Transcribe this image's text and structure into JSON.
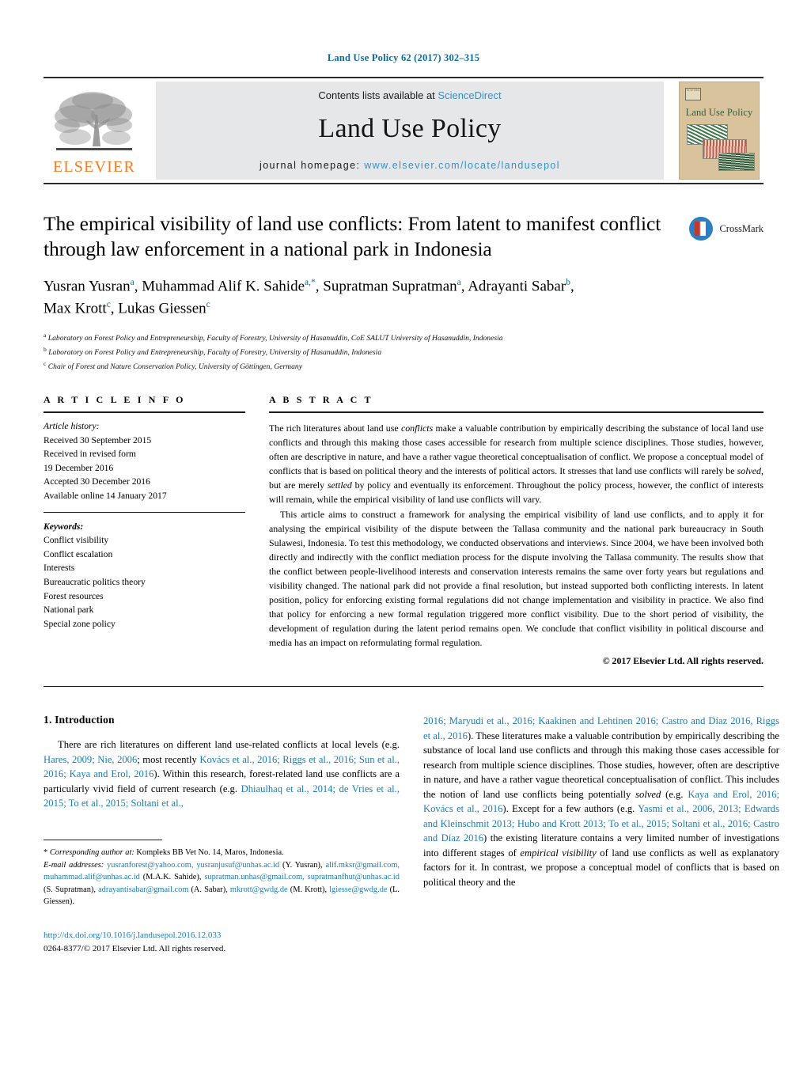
{
  "running_head": "Land Use Policy 62 (2017) 302–315",
  "banner": {
    "contents_prefix": "Contents lists available at ",
    "sciencedirect": "ScienceDirect",
    "journal_title": "Land Use Policy",
    "homepage_prefix": "journal homepage: ",
    "homepage_url": "www.elsevier.com/locate/landusepol",
    "elsevier_wordmark": "ELSEVIER",
    "cover_title": "Land Use Policy",
    "cover_logo_text": "ELSEVIER"
  },
  "colors": {
    "link_blue": "#1a7db5",
    "header_blue": "#0b6ca0",
    "elsevier_orange": "#f47b20",
    "banner_grey": "#e6e7e9",
    "cover_tan": "#d9c39c",
    "cover_green": "#2f6043"
  },
  "article": {
    "title": "The empirical visibility of land use conflicts: From latent to manifest conflict through law enforcement in a national park in Indonesia",
    "authors_line1": "Yusran Yusran",
    "authors": "Yusran Yusrana, Muhammad Alif K. Sahidea,*, Supratman Supratmana, Adrayanti Sabarb, Max Krottc, Lukas Giessenc",
    "crossmark_label": "CrossMark",
    "affiliations": [
      {
        "mark": "a",
        "text": "Laboratory on Forest Policy and Entrepreneurship, Faculty of Forestry, University of Hasanuddin, CoE SALUT University of Hasanuddin, Indonesia"
      },
      {
        "mark": "b",
        "text": "Laboratory on Forest Policy and Entrepreneurship, Faculty of Forestry, University of Hasanuddin, Indonesia"
      },
      {
        "mark": "c",
        "text": "Chair of Forest and Nature Conservation Policy, University of Göttingen, Germany"
      }
    ]
  },
  "article_info": {
    "heading": "A R T I C L E   I N F O",
    "history_label": "Article history:",
    "history": [
      "Received 30 September 2015",
      "Received in revised form",
      "19 December 2016",
      "Accepted 30 December 2016",
      "Available online 14 January 2017"
    ],
    "keywords_label": "Keywords:",
    "keywords": [
      "Conflict visibility",
      "Conflict escalation",
      "Interests",
      "Bureaucratic politics theory",
      "Forest resources",
      "National park",
      "Special zone policy"
    ]
  },
  "abstract": {
    "heading": "A B S T R A C T",
    "paragraph1_a": "The rich literatures about land use ",
    "paragraph1_i1": "conflicts",
    "paragraph1_b": " make a valuable contribution by empirically describing the substance of local land use conflicts and through this making those cases accessible for research from multiple science disciplines. Those studies, however, often are descriptive in nature, and have a rather vague theoretical conceptualisation of conflict. We propose a conceptual model of conflicts that is based on political theory and the interests of political actors. It stresses that land use conflicts will rarely be ",
    "paragraph1_i2": "solved",
    "paragraph1_c": ", but are merely ",
    "paragraph1_i3": "settled",
    "paragraph1_d": " by policy and eventually its enforcement. Throughout the policy process, however, the conflict of interests will remain, while the empirical visibility of land use conflicts will vary.",
    "paragraph2": "This article aims to construct a framework for analysing the empirical visibility of land use conflicts, and to apply it for analysing the empirical visibility of the dispute between the Tallasa community and the national park bureaucracy in South Sulawesi, Indonesia. To test this methodology, we conducted observations and interviews. Since 2004, we have been involved both directly and indirectly with the conflict mediation process for the dispute involving the Tallasa community. The results show that the conflict between people-livelihood interests and conservation interests remains the same over forty years but regulations and visibility changed. The national park did not provide a final resolution, but instead supported both conflicting interests. In latent position, policy for enforcing existing formal regulations did not change implementation and visibility in practice. We also find that policy for enforcing a new formal regulation triggered more conflict visibility. Due to the short period of visibility, the development of regulation during the latent period remains open. We conclude that conflict visibility in political discourse and media has an impact on reformulating formal regulation.",
    "copyright": "© 2017 Elsevier Ltd. All rights reserved."
  },
  "introduction": {
    "section_title": "1.  Introduction",
    "left_p1_a": "There are rich literatures on different land use-related conflicts at local levels (e.g. ",
    "left_p1_cite1": "Hares, 2009; Nie, 2006",
    "left_p1_b": "; most recently ",
    "left_p1_cite2": "Kovács et al., 2016; Riggs et al., 2016; Sun et al., 2016; Kaya and Erol, 2016",
    "left_p1_c": "). Within this research, forest-related land use conflicts are a particularly vivid field of current research (e.g. ",
    "left_p1_cite3": "Dhiaulhaq et al., 2014; de Vries et al., 2015; To et al., 2015; Soltani et al.,",
    "right_cite_start": "2016; Maryudi et al., 2016; Kaakinen and Lehtinen 2016; Castro and Díaz 2016, Riggs et al., 2016",
    "right_p1_a": "). These literatures make a valuable contribution by empirically describing the substance of local land use conflicts and through this making those cases accessible for research from multiple science disciplines. Those studies, however, often are descriptive in nature, and have a rather vague theoretical conceptualisation of conflict. This includes the notion of land use conflicts being potentially ",
    "right_p1_i1": "solved",
    "right_p1_b": " (e.g. ",
    "right_cite2": "Kaya and Erol, 2016; Kovács et al., 2016",
    "right_p1_c": "). Except for a few authors (e.g. ",
    "right_cite3": "Yasmi et al., 2006, 2013; Edwards and Kleinschmit 2013; Hubo and Krott 2013; To et al., 2015; Soltani et al., 2016; Castro and Díaz 2016",
    "right_p1_d": ") the existing literature contains a very limited number of investigations into different stages of ",
    "right_p1_i2": "empirical visibility",
    "right_p1_e": " of land use conflicts as well as explanatory factors for it. In contrast, we propose a conceptual model of conflicts that is based on political theory and the"
  },
  "footnotes": {
    "corresponding_star": "*",
    "corresponding_label": "Corresponding author at:",
    "corresponding_text": " Kompleks BB Vet No. 14, Maros, Indonesia.",
    "email_label": "E-mail addresses:",
    "emails_text": " yusranforest@yahoo.com, yusranjusuf@unhas.ac.id (Y. Yusran), alif.mksr@gmail.com, muhammad.alif@unhas.ac.id (M.A.K. Sahide), supratman.unhas@gmail.com, supratmanfhut@unhas.ac.id (S. Supratman), adrayantisabar@gmail.com (A. Sabar), mkrott@gwdg.de (M. Krott), lgiesse@gwdg.de (L. Giessen).",
    "emails": [
      {
        "mail": "yusranforest@yahoo.com, yusranjusuf@unhas.ac.id",
        "who": " (Y. Yusran), "
      },
      {
        "mail": "alif.mksr@gmail.com, muhammad.alif@unhas.ac.id",
        "who": " (M.A.K. Sahide), "
      },
      {
        "mail": "supratman.unhas@gmail.com, supratmanfhut@unhas.ac.id",
        "who": " (S. Supratman), "
      },
      {
        "mail": "adrayantisabar@gmail.com",
        "who": " (A. Sabar), "
      },
      {
        "mail": "mkrott@gwdg.de",
        "who": " (M. Krott), "
      },
      {
        "mail": "lgiesse@gwdg.de",
        "who": " (L. Giessen)."
      }
    ],
    "doi": "http://dx.doi.org/10.1016/j.landusepol.2016.12.033",
    "issn_line": "0264-8377/© 2017 Elsevier Ltd. All rights reserved."
  }
}
